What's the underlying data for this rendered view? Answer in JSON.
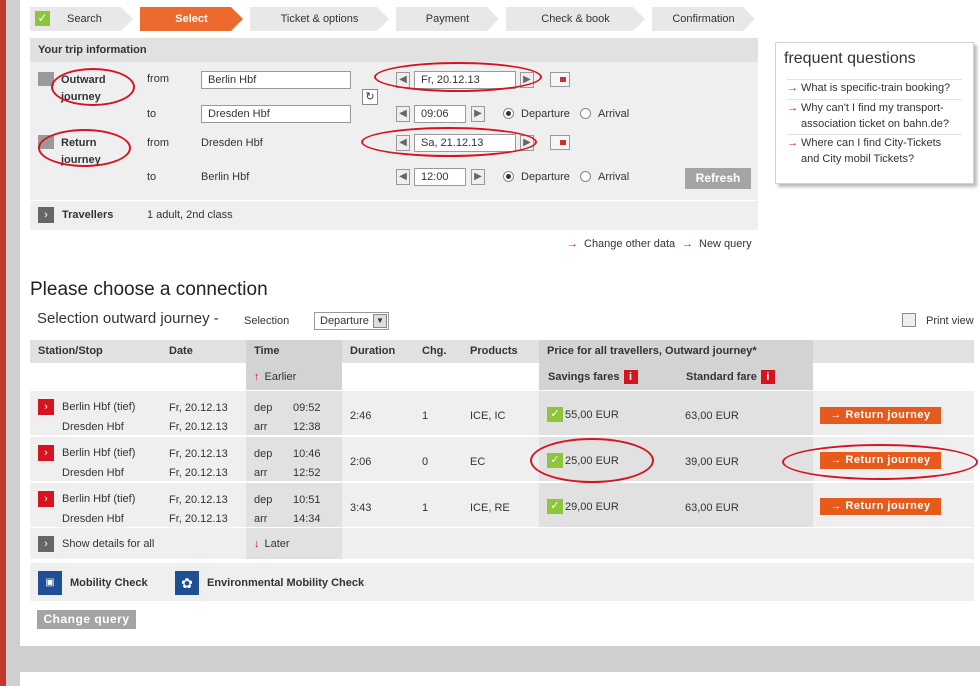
{
  "progress": {
    "steps": [
      "Search",
      "Select",
      "Ticket & options",
      "Payment",
      "Check & book",
      "Confirmation"
    ],
    "active": "Select"
  },
  "trip": {
    "title": "Your trip information",
    "outward_label": "Outward journey",
    "return_label": "Return journey",
    "from_label": "from",
    "to_label": "to",
    "outward_from": "Berlin Hbf",
    "outward_to": "Dresden Hbf",
    "outward_date": "Fr, 20.12.13",
    "outward_time": "09:06",
    "return_from": "Dresden Hbf",
    "return_to": "Berlin Hbf",
    "return_date": "Sa, 21.12.13",
    "return_time": "12:00",
    "departure_label": "Departure",
    "arrival_label": "Arrival",
    "refresh_label": "Refresh",
    "travellers_label": "Travellers",
    "travellers_value": "1 adult, 2nd class"
  },
  "links": {
    "change_other": "Change other data",
    "new_query": "New query"
  },
  "faq": {
    "title": "frequent questions",
    "items": [
      "What is specific-train booking?",
      "Why can't I find my transport-association ticket on bahn.de?",
      "Where can I find City-Tickets and City mobil Tickets?"
    ]
  },
  "connection": {
    "heading": "Please choose a connection",
    "selection_title": "Selection outward journey",
    "selection_dash": "-",
    "selection_label": "Selection",
    "selection_value": "Departure",
    "print_view": "Print view",
    "headers": {
      "station": "Station/Stop",
      "date": "Date",
      "time": "Time",
      "duration": "Duration",
      "changes": "Chg.",
      "products": "Products",
      "price": "Price for all travellers, Outward journey*"
    },
    "earlier": "Earlier",
    "later": "Later",
    "savings_label": "Savings fares",
    "standard_label": "Standard fare",
    "return_button": "Return journey",
    "show_details": "Show details for all",
    "rows": [
      {
        "from": "Berlin Hbf (tief)",
        "to": "Dresden Hbf",
        "date_from": "Fr, 20.12.13",
        "date_to": "Fr, 20.12.13",
        "dep_label": "dep",
        "arr_label": "arr",
        "dep": "09:52",
        "arr": "12:38",
        "duration": "2:46",
        "changes": "1",
        "products": "ICE, IC",
        "savings": "55,00 EUR",
        "standard": "63,00 EUR"
      },
      {
        "from": "Berlin Hbf (tief)",
        "to": "Dresden Hbf",
        "date_from": "Fr, 20.12.13",
        "date_to": "Fr, 20.12.13",
        "dep_label": "dep",
        "arr_label": "arr",
        "dep": "10:46",
        "arr": "12:52",
        "duration": "2:06",
        "changes": "0",
        "products": "EC",
        "savings": "25,00 EUR",
        "standard": "39,00 EUR"
      },
      {
        "from": "Berlin Hbf (tief)",
        "to": "Dresden Hbf",
        "date_from": "Fr, 20.12.13",
        "date_to": "Fr, 20.12.13",
        "dep_label": "dep",
        "arr_label": "arr",
        "dep": "10:51",
        "arr": "14:34",
        "duration": "3:43",
        "changes": "1",
        "products": "ICE, RE",
        "savings": "29,00 EUR",
        "standard": "63,00 EUR"
      }
    ]
  },
  "bottom": {
    "mobility": "Mobility Check",
    "environmental": "Environmental Mobility Check",
    "change_query": "Change query"
  },
  "colors": {
    "accent": "#ec6a2d",
    "red": "#d6141f",
    "green": "#8fc53d"
  }
}
